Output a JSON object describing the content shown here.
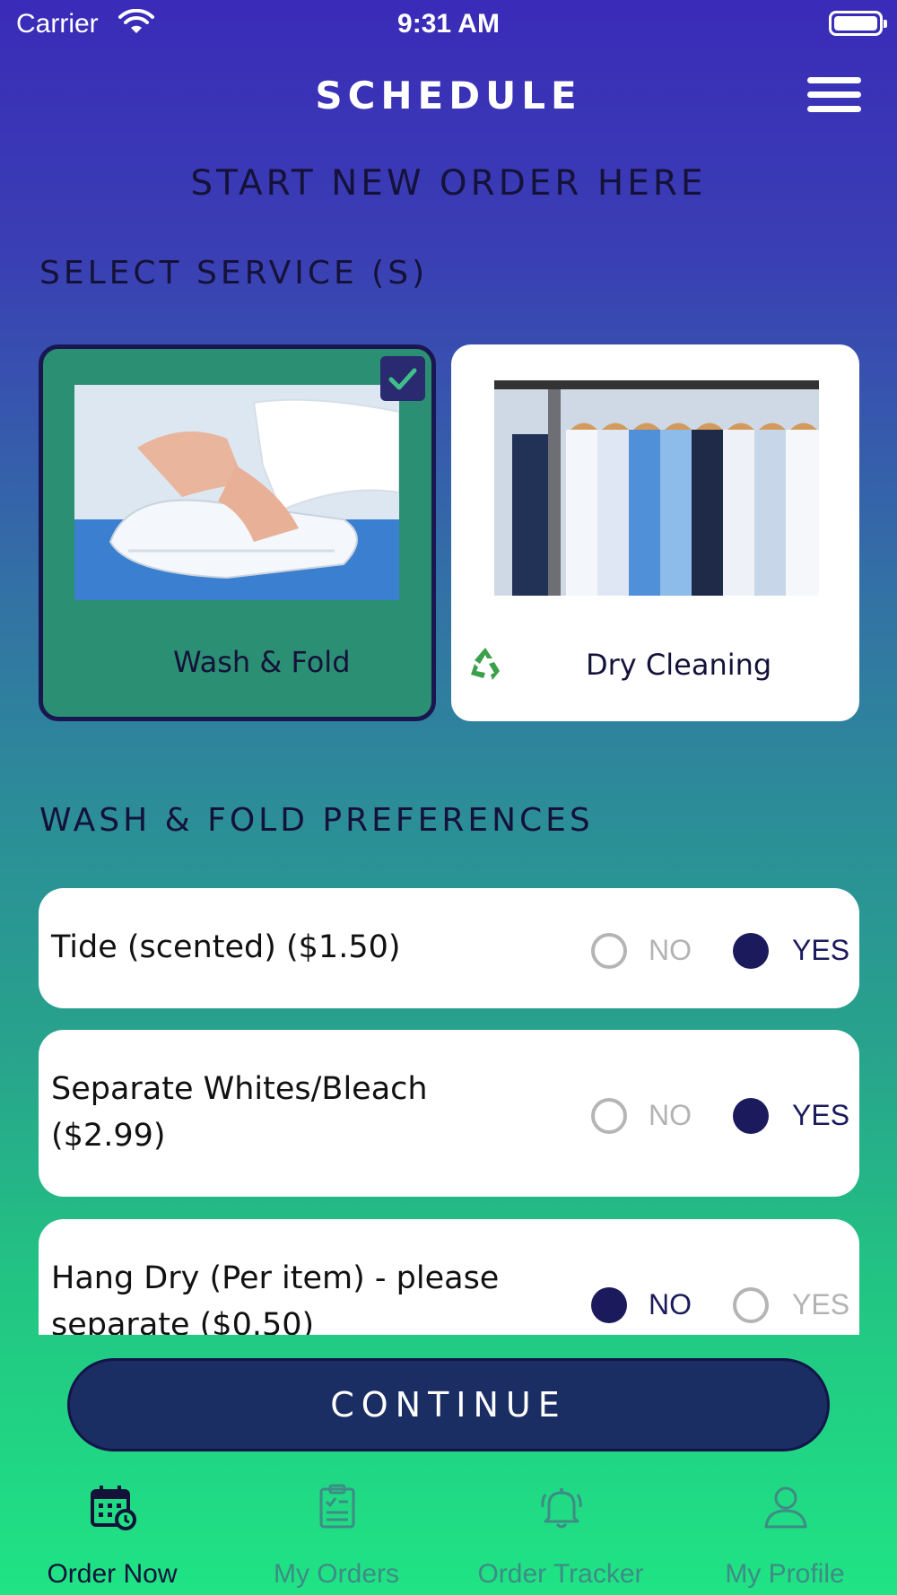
{
  "status_bar": {
    "carrier": "Carrier",
    "time": "9:31 AM"
  },
  "header": {
    "title": "SCHEDULE",
    "subtitle": "START NEW ORDER HERE"
  },
  "services": {
    "section_label": "SELECT SERVICE (S)",
    "items": [
      {
        "label": "Wash & Fold",
        "selected": true
      },
      {
        "label": "Dry Cleaning",
        "selected": false,
        "badge_icon": "recycle-icon"
      }
    ]
  },
  "preferences": {
    "section_label": "WASH & FOLD PREFERENCES",
    "items": [
      {
        "label": "Tide (scented)  ($1.50)",
        "no_label": "NO",
        "yes_label": "YES",
        "value": "YES"
      },
      {
        "label": "Separate Whites/Bleach ($2.99)",
        "no_label": "NO",
        "yes_label": "YES",
        "value": "YES"
      },
      {
        "label": "Hang Dry (Per item) - please separate ($0.50)",
        "no_label": "NO",
        "yes_label": "YES",
        "value": "NO"
      }
    ]
  },
  "continue_label": "CONTINUE",
  "tabbar": {
    "tabs": [
      {
        "label": "Order Now",
        "icon": "calendar-clock-icon",
        "active": true
      },
      {
        "label": "My Orders",
        "icon": "clipboard-list-icon",
        "active": false
      },
      {
        "label": "Order Tracker",
        "icon": "bell-icon",
        "active": false
      },
      {
        "label": "My Profile",
        "icon": "user-icon",
        "active": false
      }
    ]
  },
  "colors": {
    "accent_dark": "#1b1a5c",
    "selected_card": "#2b8f73",
    "continue_button": "#1b2e63",
    "inactive_tab": "#3f8b86"
  }
}
